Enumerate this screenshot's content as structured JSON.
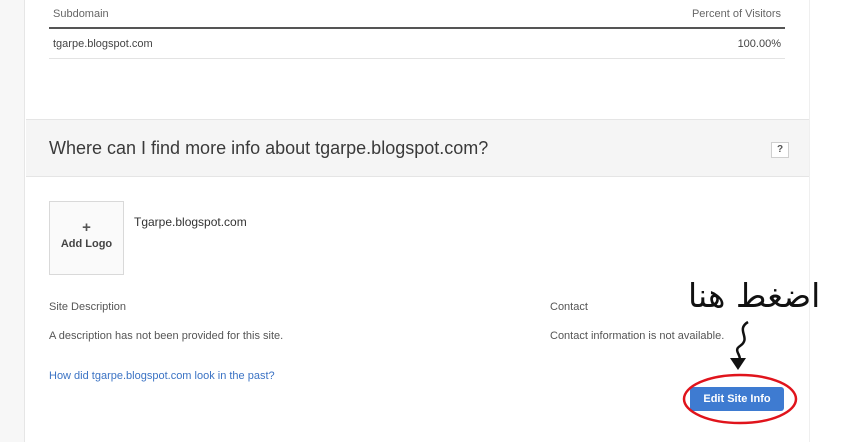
{
  "table": {
    "headers": {
      "subdomain": "Subdomain",
      "percent": "Percent of Visitors"
    },
    "rows": [
      {
        "subdomain": "tgarpe.blogspot.com",
        "percent": "100.00%"
      }
    ]
  },
  "section": {
    "title": "Where can I find more info about tgarpe.blogspot.com?",
    "help": "?"
  },
  "logo": {
    "plus": "+",
    "label": "Add Logo"
  },
  "site": {
    "name": "Tgarpe.blogspot.com"
  },
  "description": {
    "label": "Site Description",
    "value": "A description has not been provided for this site."
  },
  "contact": {
    "label": "Contact",
    "value": "Contact information is not available."
  },
  "past_link": "How did tgarpe.blogspot.com look in the past?",
  "edit_button": "Edit Site Info",
  "annotation": {
    "text": "اضغط هنا",
    "color": "#e0141c"
  }
}
